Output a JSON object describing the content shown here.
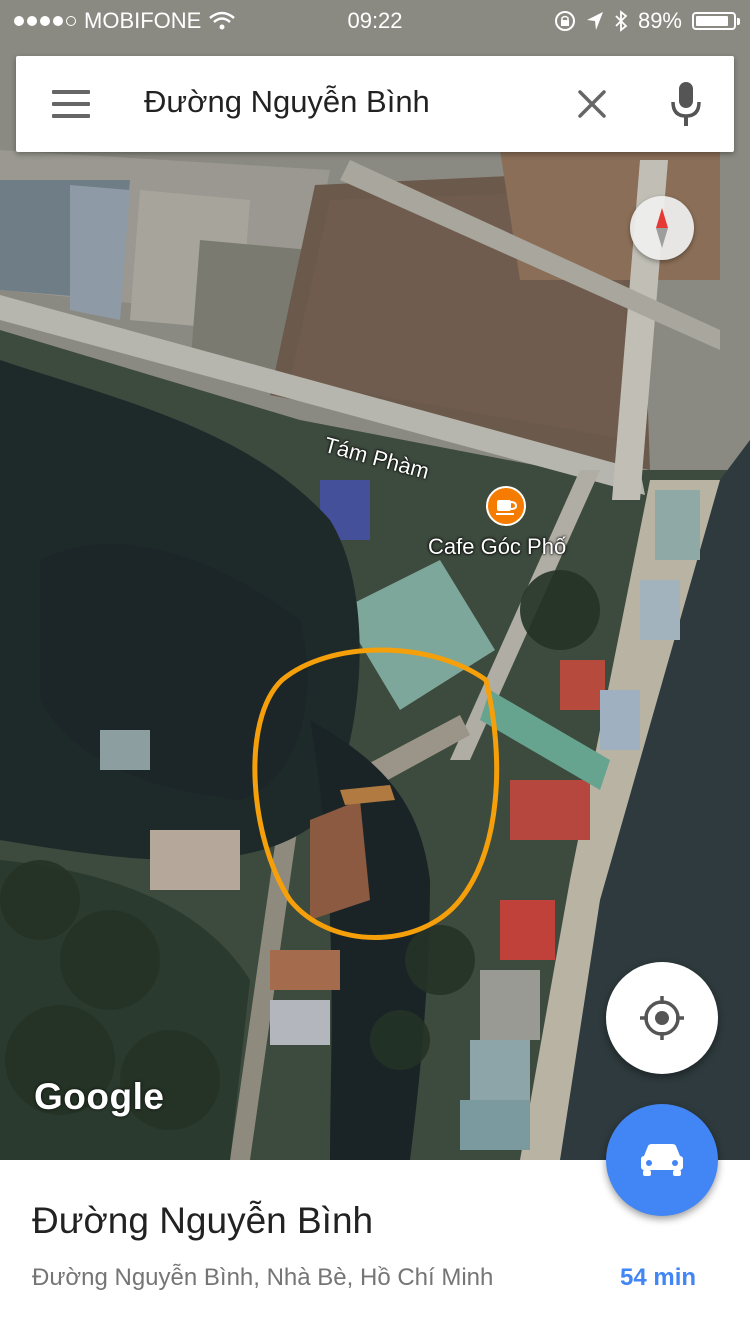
{
  "status_bar": {
    "carrier": "MOBIFONE",
    "time": "09:22",
    "battery": "89%",
    "battery_level": 0.89
  },
  "search": {
    "query": "Đường Nguyễn Bình",
    "menu_icon": "hamburger-menu-icon",
    "clear_icon": "close-icon",
    "voice_icon": "microphone-icon"
  },
  "map": {
    "road_label": "Tám Phàm",
    "poi": {
      "name": "Cafe Góc Phố",
      "icon": "coffee-cup-icon",
      "color": "#f57c00"
    },
    "attribution": "Google",
    "annotation_color": "#f5a00a",
    "compass_icon": "compass-icon"
  },
  "controls": {
    "my_location_icon": "my-location-icon",
    "directions_icon": "car-icon",
    "directions_color": "#4285f4"
  },
  "place": {
    "title": "Đường Nguyễn Bình",
    "address": "Đường Nguyễn Bình, Nhà Bè, Hồ Chí Minh",
    "travel_time": "54 min"
  }
}
